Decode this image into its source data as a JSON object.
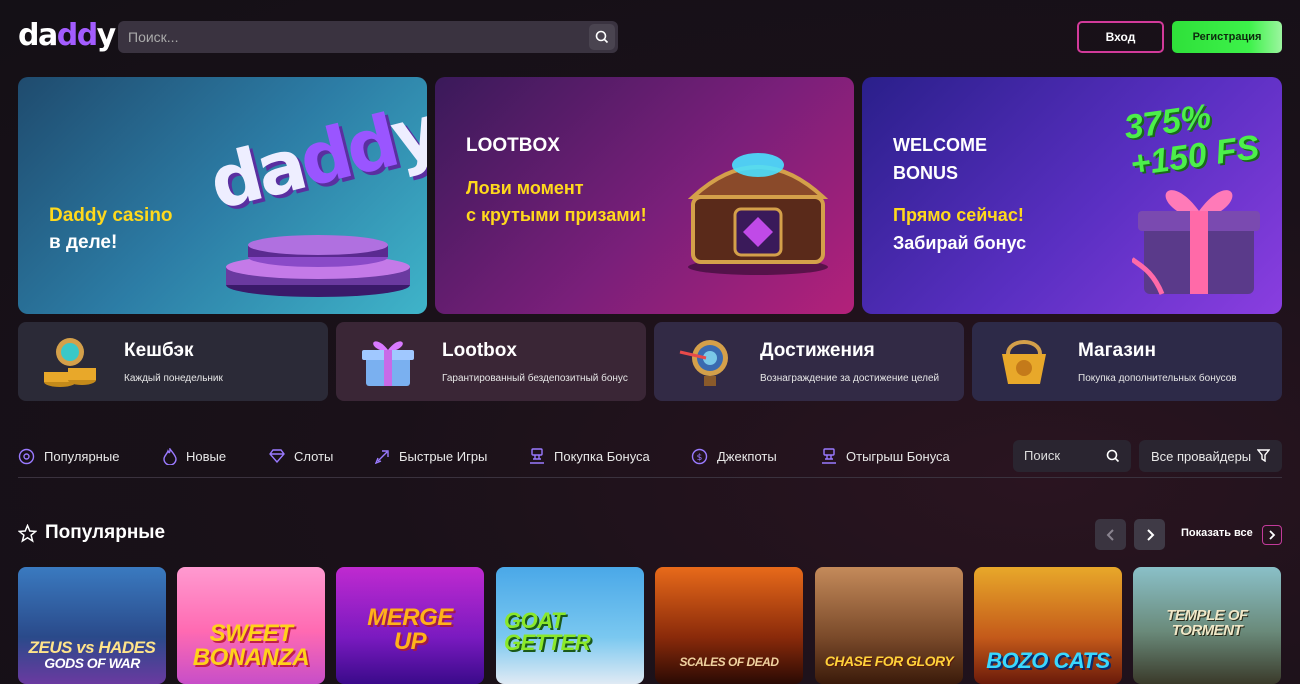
{
  "header": {
    "logo_text_a": "da",
    "logo_text_b": "dd",
    "logo_text_c": "y",
    "search_placeholder": "Поиск...",
    "login_label": "Вход",
    "register_label": "Регистрация"
  },
  "banners": [
    {
      "logo_a": "da",
      "logo_b": "dd",
      "logo_c": "y",
      "title_yellow": "Daddy casino",
      "title_white": "в деле!"
    },
    {
      "title": "LOOTBOX",
      "line1": "Лови момент",
      "line2": "с крутыми призами!"
    },
    {
      "title1": "WELCOME",
      "title2": "BONUS",
      "percent": "375%",
      "fs": "+150 FS",
      "line_yellow": "Прямо сейчас!",
      "line_white": "Забирай бонус"
    }
  ],
  "features": [
    {
      "title": "Кешбэк",
      "subtitle": "Каждый понедельник"
    },
    {
      "title": "Lootbox",
      "subtitle": "Гарантированный бездепозитный бонус"
    },
    {
      "title": "Достижения",
      "subtitle": "Вознаграждение за достижение целей"
    },
    {
      "title": "Магазин",
      "subtitle": "Покупка дополнительных бонусов"
    }
  ],
  "categories": [
    {
      "label": "Популярные",
      "icon": "flower-icon"
    },
    {
      "label": "Новые",
      "icon": "flame-icon"
    },
    {
      "label": "Слоты",
      "icon": "diamond-icon"
    },
    {
      "label": "Быстрые Игры",
      "icon": "rocket-icon"
    },
    {
      "label": "Покупка Бонуса",
      "icon": "podium-icon"
    },
    {
      "label": "Джекпоты",
      "icon": "coin-icon"
    },
    {
      "label": "Отыгрыш Бонуса",
      "icon": "podium-icon"
    }
  ],
  "category_search_placeholder": "Поиск",
  "providers_label": "Все провайдеры",
  "popular": {
    "title": "Популярные",
    "show_all": "Показать все",
    "games": [
      {
        "line1": "ZEUS vs HADES",
        "line2": "GODS OF WAR"
      },
      {
        "line1": "SWEET",
        "line2": "BONANZA"
      },
      {
        "line1": "MERGE",
        "line2": "UP"
      },
      {
        "line1": "GOAT",
        "line2": "GETTER"
      },
      {
        "line1": "SCALES OF DEAD",
        "line2": ""
      },
      {
        "line1": "CHASE FOR GLORY",
        "line2": ""
      },
      {
        "line1": "BOZO CATS",
        "line2": ""
      },
      {
        "line1": "TEMPLE OF TORMENT",
        "line2": ""
      }
    ]
  },
  "colors": {
    "accent_purple": "#a35cff",
    "accent_pink": "#d23a9a",
    "accent_green": "#2fe03a",
    "yellow_text": "#ffd91c"
  }
}
